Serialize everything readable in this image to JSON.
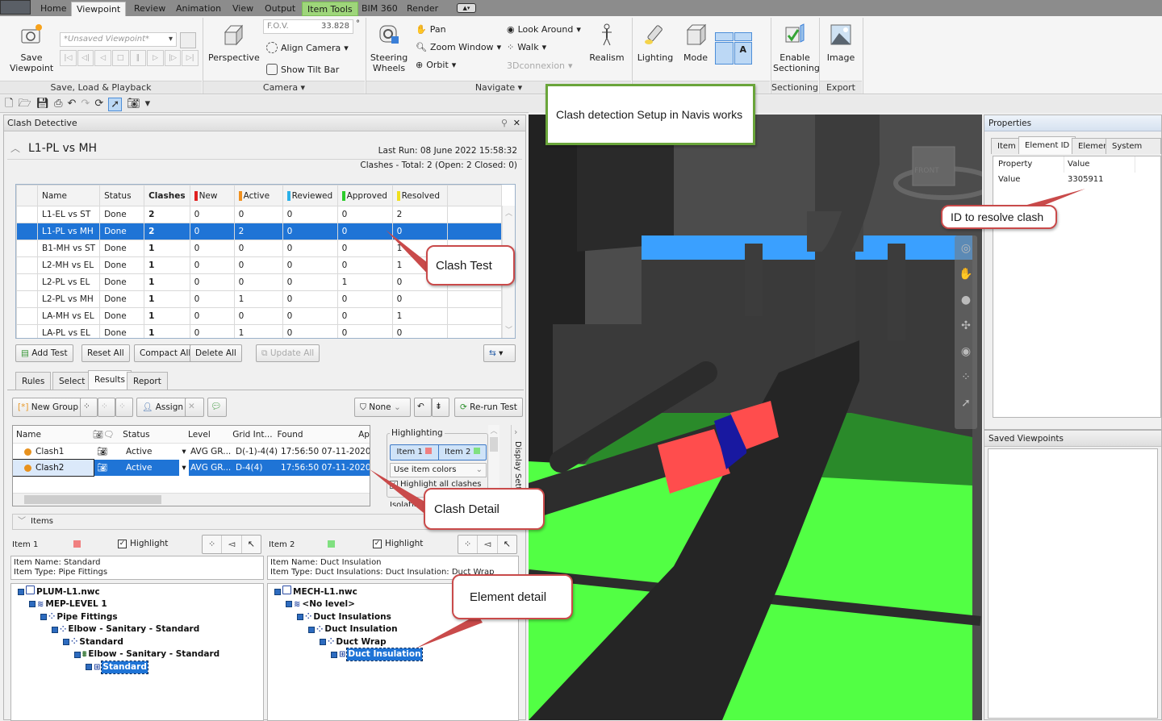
{
  "ribbon": {
    "tabs": [
      "Home",
      "Viewpoint",
      "Review",
      "Animation",
      "View",
      "Output",
      "Item Tools",
      "BIM 360",
      "Render"
    ],
    "active_tab": "Viewpoint",
    "context_tab": "Item Tools",
    "groups": {
      "save_load_playback": {
        "label": "Save, Load & Playback",
        "save_viewpoint": "Save Viewpoint",
        "viewpoint_select": "*Unsaved Viewpoint*"
      },
      "camera": {
        "label": "Camera",
        "perspective": "Perspective",
        "fov_label": "F.O.V.",
        "fov_value": "33.828",
        "fov_unit": "°",
        "align_camera": "Align Camera",
        "show_tilt_bar": "Show Tilt Bar"
      },
      "navigate": {
        "label": "Navigate",
        "steering_wheels": "Steering Wheels",
        "pan": "Pan",
        "zoom_window": "Zoom Window",
        "orbit": "Orbit",
        "look_around": "Look Around",
        "walk": "Walk",
        "connexion": "3Dconnexion",
        "realism": "Realism"
      },
      "render_style": {
        "lighting": "Lighting",
        "mode": "Mode",
        "text_a": "A"
      },
      "sectioning": {
        "label": "Sectioning",
        "enable_sectioning": "Enable Sectioning"
      },
      "export": {
        "label": "Export",
        "image": "Image"
      }
    }
  },
  "clash_detective": {
    "title": "Clash Detective",
    "test_name": "L1-PL vs MH",
    "last_run": "Last Run:  08 June 2022 15:58:32",
    "summary": "Clashes -  Total:  2  (Open:  2  Closed:  0)",
    "columns": [
      "Name",
      "Status",
      "Clashes",
      "New",
      "Active",
      "Reviewed",
      "Approved",
      "Resolved"
    ],
    "column_colors": {
      "New": "#e02020",
      "Active": "#f0901e",
      "Reviewed": "#2ab0e8",
      "Approved": "#2ccc2c",
      "Resolved": "#f0e020"
    },
    "tests": [
      {
        "name": "L1-EL vs ST",
        "status": "Done",
        "clashes": "2",
        "new": "0",
        "active": "0",
        "reviewed": "0",
        "approved": "0",
        "resolved": "2"
      },
      {
        "name": "L1-PL vs MH",
        "status": "Done",
        "clashes": "2",
        "new": "0",
        "active": "2",
        "reviewed": "0",
        "approved": "0",
        "resolved": "0",
        "selected": true
      },
      {
        "name": "B1-MH vs ST",
        "status": "Done",
        "clashes": "1",
        "new": "0",
        "active": "0",
        "reviewed": "0",
        "approved": "0",
        "resolved": "1"
      },
      {
        "name": "L2-MH vs EL",
        "status": "Done",
        "clashes": "1",
        "new": "0",
        "active": "0",
        "reviewed": "0",
        "approved": "0",
        "resolved": "1"
      },
      {
        "name": "L2-PL vs EL",
        "status": "Done",
        "clashes": "1",
        "new": "0",
        "active": "0",
        "reviewed": "0",
        "approved": "1",
        "resolved": "0"
      },
      {
        "name": "L2-PL vs MH",
        "status": "Done",
        "clashes": "1",
        "new": "0",
        "active": "1",
        "reviewed": "0",
        "approved": "0",
        "resolved": "0"
      },
      {
        "name": "LA-MH vs EL",
        "status": "Done",
        "clashes": "1",
        "new": "0",
        "active": "0",
        "reviewed": "0",
        "approved": "0",
        "resolved": "1"
      },
      {
        "name": "LA-PL vs EL",
        "status": "Done",
        "clashes": "1",
        "new": "0",
        "active": "1",
        "reviewed": "0",
        "approved": "0",
        "resolved": "0"
      }
    ],
    "buttons": {
      "add_test": "Add Test",
      "reset_all": "Reset All",
      "compact_all": "Compact All",
      "delete_all": "Delete All",
      "update_all": "Update All"
    },
    "panel_tabs": [
      "Rules",
      "Select",
      "Results",
      "Report"
    ],
    "active_panel_tab": "Results",
    "results_toolbar": {
      "new_group": "New Group",
      "assign": "Assign",
      "filter": "None",
      "rerun": "Re-run Test"
    },
    "results_columns": [
      "Name",
      "Status",
      "Level",
      "Grid Int...",
      "Found",
      "Ap"
    ],
    "results": [
      {
        "name": "Clash1",
        "status": "Active",
        "level": "AVG GR...",
        "grid": "D(-1)-4(4)",
        "found": "17:56:50 07-11-2020"
      },
      {
        "name": "Clash2",
        "status": "Active",
        "level": "AVG GR...",
        "grid": "D-4(4)",
        "found": "17:56:50 07-11-2020",
        "selected": true
      }
    ],
    "highlighting": {
      "label": "Highlighting",
      "item1": "Item 1",
      "item2": "Item 2",
      "item1_color": "#f08080",
      "item2_color": "#80e080",
      "mode": "Use item colors",
      "highlight_all": "Highlight all clashes",
      "highlight_all_checked": true,
      "isolation_label": "Isolation"
    },
    "display_settings": "Display Settings",
    "items_section": "Items",
    "item1": {
      "label": "Item 1",
      "highlight": "Highlight",
      "highlight_checked": true,
      "name_line": "Item Name: Standard",
      "type_line": "Item Type: Pipe Fittings",
      "tree": [
        {
          "label": "PLUM-L1.nwc",
          "depth": 0,
          "icon": "file-icon"
        },
        {
          "label": "MEP-LEVEL 1",
          "depth": 1,
          "icon": "layer-icon"
        },
        {
          "label": "Pipe Fittings",
          "depth": 2,
          "icon": "group-icon"
        },
        {
          "label": "Elbow - Sanitary - Standard",
          "depth": 3,
          "icon": "group-icon"
        },
        {
          "label": "Standard",
          "depth": 4,
          "icon": "group-icon"
        },
        {
          "label": "Elbow - Sanitary - Standard",
          "depth": 5,
          "icon": "insert-icon"
        },
        {
          "label": "Standard",
          "depth": 6,
          "icon": "geometry-icon",
          "selected": true
        }
      ]
    },
    "item2": {
      "label": "Item 2",
      "highlight": "Highlight",
      "highlight_checked": true,
      "name_line": "Item Name: Duct Insulation",
      "type_line": "Item Type: Duct Insulations: Duct Insulation: Duct Wrap",
      "tree": [
        {
          "label": "MECH-L1.nwc",
          "depth": 0,
          "icon": "file-icon"
        },
        {
          "label": "<No level>",
          "depth": 1,
          "icon": "layer-icon"
        },
        {
          "label": "Duct Insulations",
          "depth": 2,
          "icon": "group-icon"
        },
        {
          "label": "Duct Insulation",
          "depth": 3,
          "icon": "group-icon"
        },
        {
          "label": "Duct Wrap",
          "depth": 4,
          "icon": "group-icon"
        },
        {
          "label": "Duct Insulation",
          "depth": 5,
          "icon": "geometry-icon",
          "selected": true
        }
      ]
    }
  },
  "viewport": {
    "viewcube_face": "FRONT"
  },
  "properties": {
    "title": "Properties",
    "tabs": [
      "Item",
      "Element ID",
      "Element",
      "System Type"
    ],
    "active_tab": "Element ID",
    "columns": [
      "Property",
      "Value"
    ],
    "rows": [
      {
        "property": "Value",
        "value": "3305911"
      }
    ]
  },
  "saved_viewpoints": {
    "title": "Saved Viewpoints"
  },
  "callouts": {
    "setup": "Clash detection Setup in Navis works",
    "clash_test": "Clash Test",
    "clash_detail": "Clash Detail",
    "element_detail": "Element detail",
    "id_resolve": "ID to resolve clash"
  }
}
